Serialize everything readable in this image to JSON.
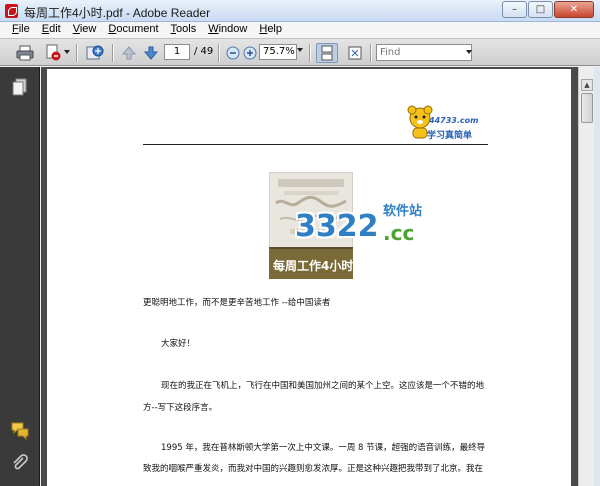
{
  "window": {
    "title": "每周工作4小时.pdf - Adobe Reader",
    "controls": {
      "minimize": "–",
      "maximize": "□",
      "close": "✕"
    }
  },
  "menu": {
    "items": [
      {
        "label": "File",
        "accel": "F",
        "rest": "ile"
      },
      {
        "label": "Edit",
        "accel": "E",
        "rest": "dit"
      },
      {
        "label": "View",
        "accel": "V",
        "rest": "iew"
      },
      {
        "label": "Document",
        "accel": "D",
        "rest": "ocument"
      },
      {
        "label": "Tools",
        "accel": "T",
        "rest": "ools"
      },
      {
        "label": "Window",
        "accel": "W",
        "rest": "indow"
      },
      {
        "label": "Help",
        "accel": "H",
        "rest": "elp"
      }
    ]
  },
  "toolbar": {
    "page_current": "1",
    "page_total": "/ 49",
    "zoom_value": "75.7%",
    "find_placeholder": "Find"
  },
  "document": {
    "header_logo_top": "44733.com",
    "header_logo_bottom": "学习真简单",
    "watermark_main": "3322",
    "watermark_cc": ".cc",
    "watermark_cn": "软件站",
    "cover_title": "每周工作4小时",
    "lines": [
      "更聪明地工作，而不是更辛苦地工作 --给中国读者",
      "大家好！",
      "现在的我正在飞机上，飞行在中国和美国加州之间的某个上空。这应该是一个不错的地",
      "方--写下这段序言。",
      "1995 年，我在普林斯顿大学第一次上中文课。一周 8 节课，超强的语音训练，最终导",
      "致我的咽喉严重发炎，而我对中国的兴趣则愈发浓厚。正是这种兴趣把我带到了北京。我在"
    ]
  },
  "colors": {
    "accent": "#3a5fa0",
    "nav_panel": "#3a3a3a",
    "doc_background": "#4a4a4a",
    "watermark_blue": "#2f7fc4",
    "watermark_green": "#4ca32f"
  }
}
